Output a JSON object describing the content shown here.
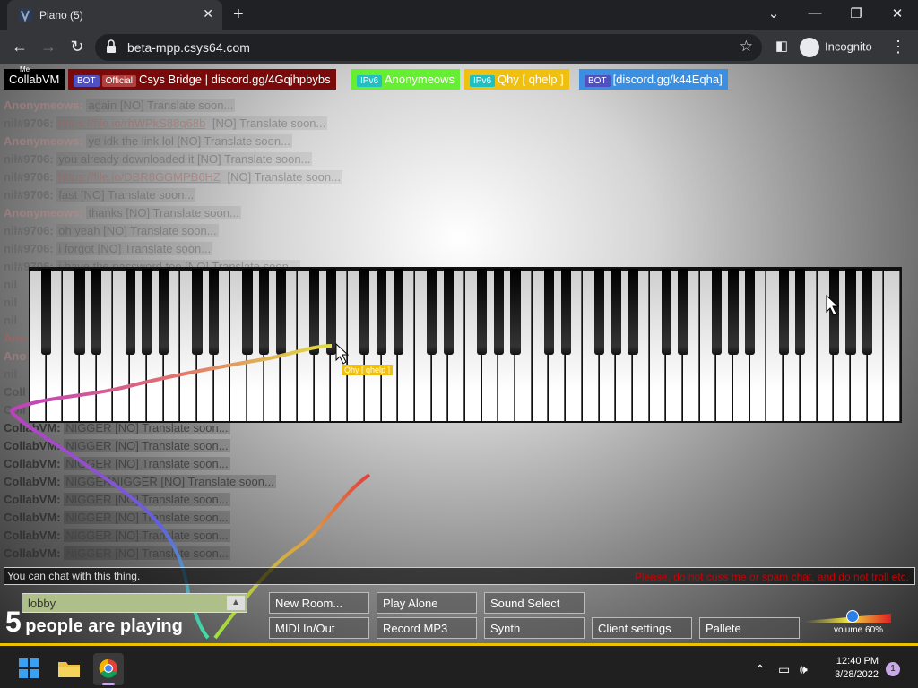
{
  "browser": {
    "tab_title": "Piano (5)",
    "url": "beta-mpp.csys64.com",
    "incognito_label": "Incognito"
  },
  "users": [
    {
      "name": "CollabVM",
      "badges": [],
      "bg": "#000000",
      "color": "#ffffff",
      "small": "Me"
    },
    {
      "name": "Csys Bridge | discord.gg/4Gqjhpbybs",
      "badges": [
        "BOT",
        "Official"
      ],
      "bg": "#7a0a0a",
      "color": "#ffffff"
    },
    {
      "name": "Anonymeows",
      "badges": [
        "IPv6"
      ],
      "bg": "#66ee33",
      "color": "#ffffff"
    },
    {
      "name": "Qhy [ qhelp ]",
      "badges": [
        "IPv6"
      ],
      "bg": "#f0c010",
      "color": "#ffffff"
    },
    {
      "name": "[discord.gg/k44Eqha]",
      "badges": [
        "BOT"
      ],
      "bg": "#3a8fe0",
      "color": "#ffffff"
    }
  ],
  "chat": [
    {
      "who": "Anonymeows:",
      "text": "again [NO] Translate soon...",
      "color": "#c88"
    },
    {
      "who": "nil#9706:",
      "text": "https://file.io/rhWPkS88q68b",
      "link": true,
      "suffix": "[NO] Translate soon...",
      "color": "#555"
    },
    {
      "who": "Anonymeows:",
      "text": "ye idk the link lol [NO] Translate soon...",
      "color": "#c88"
    },
    {
      "who": "nil#9706:",
      "text": "you already downloaded it [NO] Translate soon...",
      "color": "#555"
    },
    {
      "who": "nil#9706:",
      "text": "https://file.io/DBR8GGMPB6HZ",
      "link": true,
      "suffix": "[NO] Translate soon...",
      "color": "#555"
    },
    {
      "who": "nil#9706:",
      "text": "fast [NO] Translate soon...",
      "color": "#555"
    },
    {
      "who": "Anonymeows:",
      "text": "thanks [NO] Translate soon...",
      "color": "#c88"
    },
    {
      "who": "nil#9706:",
      "text": "oh yeah [NO] Translate soon...",
      "color": "#555"
    },
    {
      "who": "nil#9706:",
      "text": "i forgot [NO] Translate soon...",
      "color": "#555"
    },
    {
      "who": "nil#9706:",
      "text": "i have the password too [NO] Translate soon...",
      "color": "#555"
    },
    {
      "who": "nil",
      "text": "",
      "color": "#555"
    },
    {
      "who": "nil",
      "text": "",
      "color": "#555"
    },
    {
      "who": "nil",
      "text": "",
      "color": "#555"
    },
    {
      "who": "Ano",
      "text": "",
      "color": "#c55"
    },
    {
      "who": "Ano",
      "text": "",
      "color": "#c88"
    },
    {
      "who": "nil",
      "text": "",
      "color": "#555"
    },
    {
      "who": "Coll",
      "text": "",
      "color": "#555"
    },
    {
      "who": "Coll",
      "text": "",
      "color": "#555"
    },
    {
      "who": "CollabVM:",
      "text": "NIGGER [NO] Translate soon...",
      "color": "#333"
    },
    {
      "who": "CollabVM:",
      "text": "NIGGER [NO] Translate soon...",
      "color": "#333"
    },
    {
      "who": "CollabVM:",
      "text": "NIGGER [NO] Translate soon...",
      "color": "#333"
    },
    {
      "who": "CollabVM:",
      "text": "NIGGERNIGGER [NO] Translate soon...",
      "color": "#333"
    },
    {
      "who": "CollabVM:",
      "text": "NIGGER [NO] Translate soon...",
      "color": "#333"
    },
    {
      "who": "CollabVM:",
      "text": "NIGGER [NO] Translate soon...",
      "color": "#333"
    },
    {
      "who": "CollabVM:",
      "text": "NIGGER [NO] Translate soon...",
      "color": "#333"
    },
    {
      "who": "CollabVM:",
      "text": "NIGGER [NO] Translate soon...",
      "color": "#333"
    }
  ],
  "cursor_label": "Qhy [ qhelp ]",
  "chat_input": {
    "placeholder": "You can chat with this thing.",
    "warning": "Please, do not cuss me or spam chat, and do not troll etc."
  },
  "room": {
    "name": "lobby"
  },
  "playing": {
    "count": "5",
    "text": "people are playing"
  },
  "buttons": {
    "new_room": "New Room...",
    "play_alone": "Play Alone",
    "sound_select": "Sound Select",
    "midi": "MIDI In/Out",
    "record": "Record MP3",
    "synth": "Synth",
    "client_settings": "Client settings",
    "pallete": "Pallete"
  },
  "volume": {
    "label": "volume 60%",
    "level": 0.6
  },
  "taskbar": {
    "time": "12:40 PM",
    "date": "3/28/2022",
    "notifications": "1"
  }
}
